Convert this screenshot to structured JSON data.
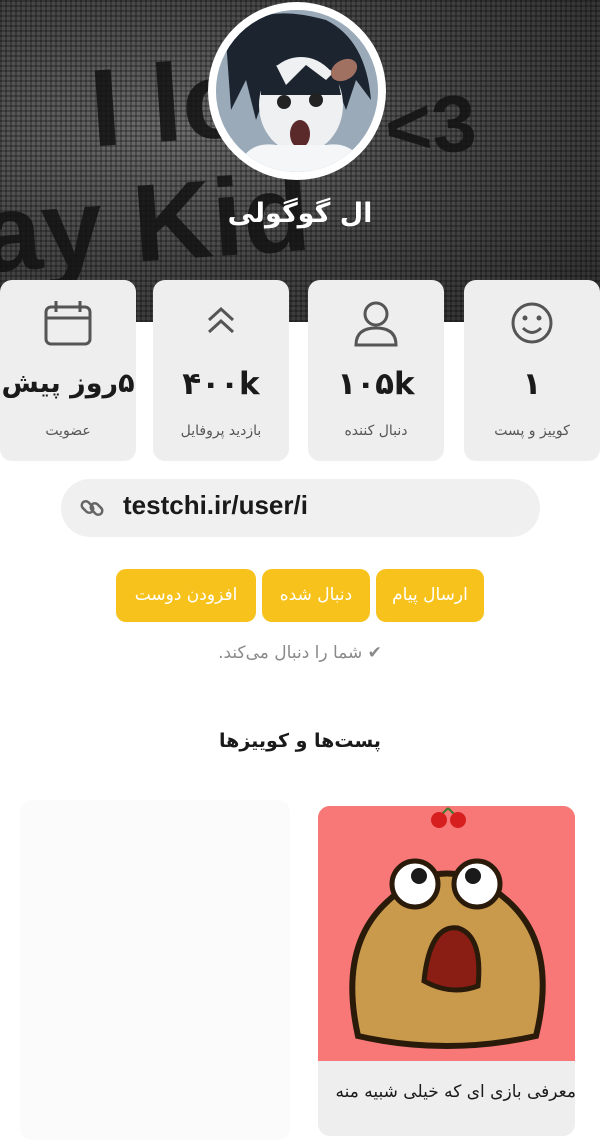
{
  "cover": {
    "background_text": [
      "I lo",
      "ay Kid",
      "<3"
    ]
  },
  "profile": {
    "name": "ال گوگولی"
  },
  "stats": [
    {
      "value": "۵روز پیش",
      "label": "عضویت",
      "icon": "calendar-icon"
    },
    {
      "value": "۴۰۰k",
      "label": "بازدید پروفایل",
      "icon": "double-chevron-up-icon"
    },
    {
      "value": "۱۰۵k",
      "label": "دنبال کننده",
      "icon": "user-icon"
    },
    {
      "value": "۱",
      "label": "کوییز و پست",
      "icon": "smiley-icon"
    }
  ],
  "profile_link": {
    "text": "testchi.ir/user/i",
    "icon": "link-icon"
  },
  "actions": {
    "send_message": "ارسال پیام",
    "followed": "دنبال شده",
    "add_friend": "افزودن دوست"
  },
  "follows_you": "✔ شما را دنبال می‌کند.",
  "section_title": "پست‌ها و کوییزها",
  "posts": [
    {
      "title": "معرفی بازی ای که خیلی شبیه منه"
    }
  ],
  "colors": {
    "accent": "#f8c21d",
    "card_bg": "#eeeeee",
    "post_bg": "#f87878"
  }
}
